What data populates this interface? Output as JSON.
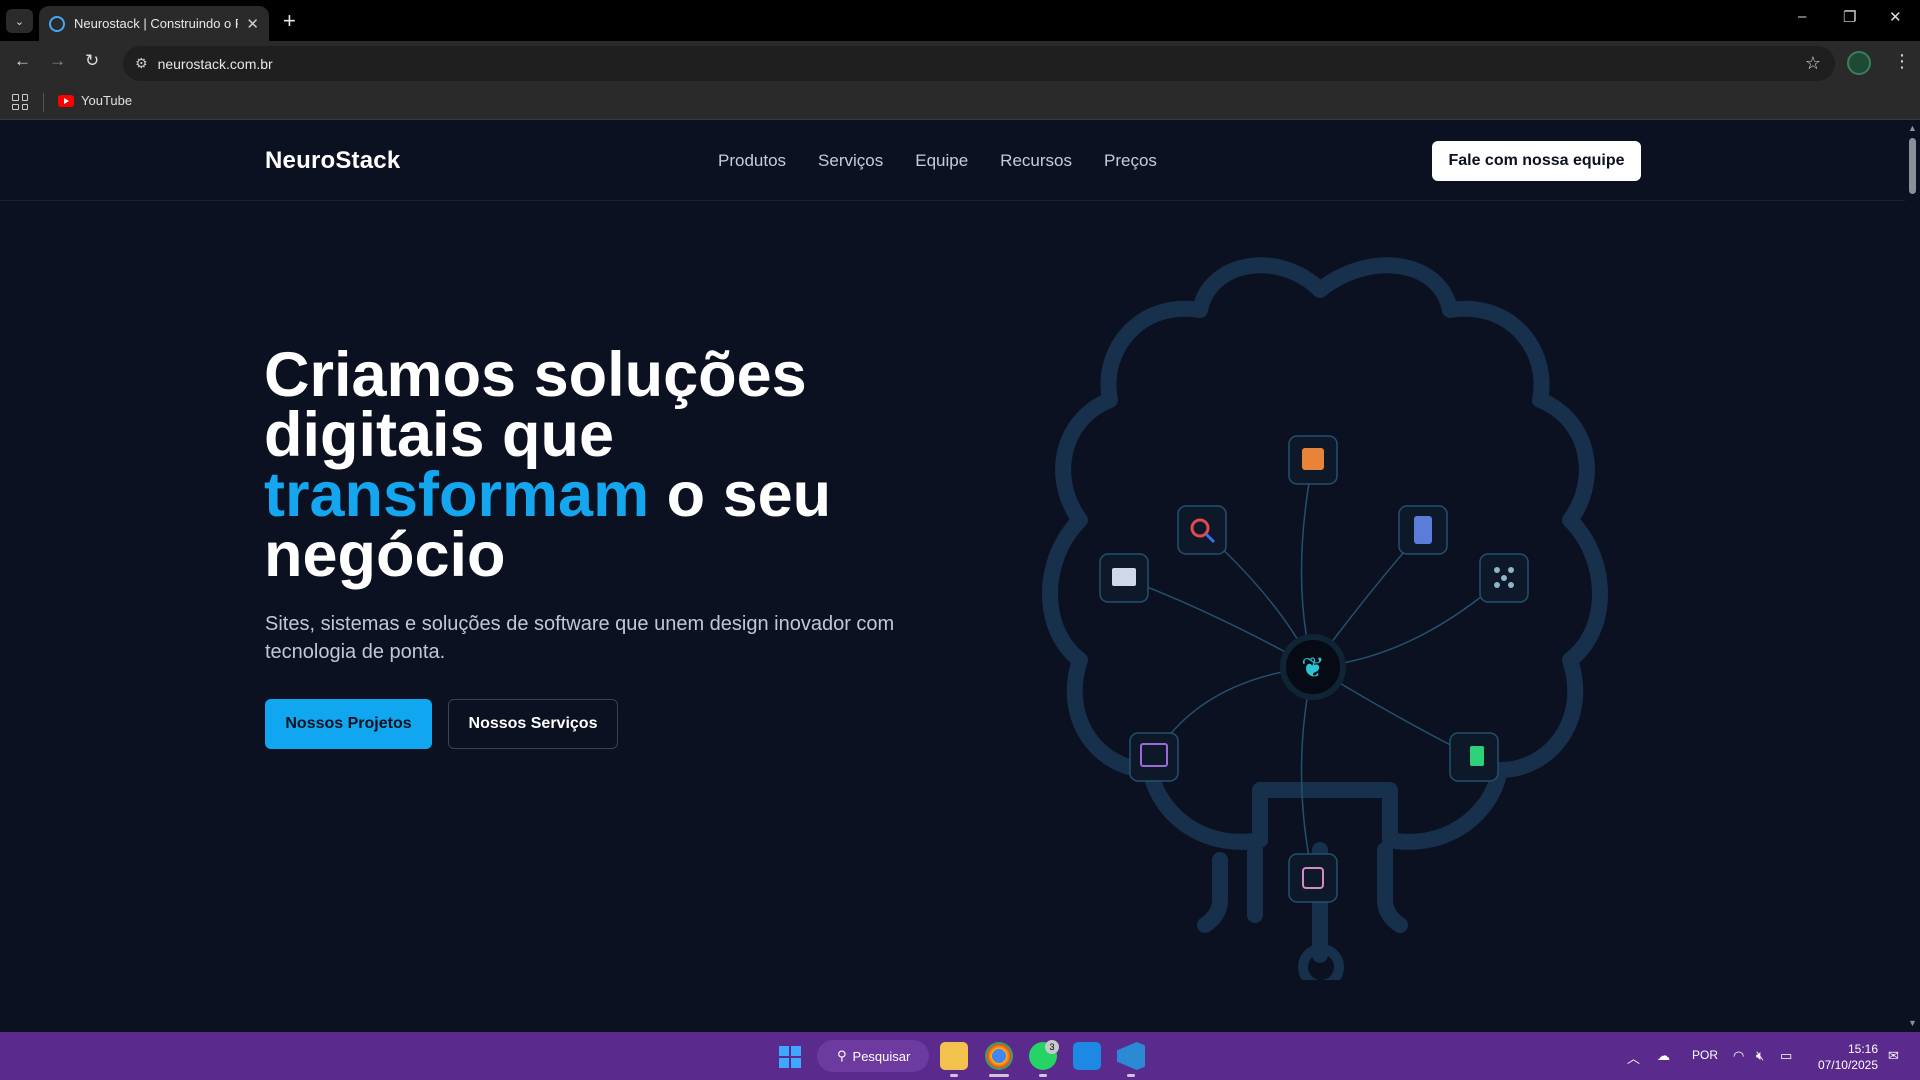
{
  "browser": {
    "tab_title": "Neurostack | Construindo o Futuro",
    "new_tab": "+",
    "tab_close": "✕",
    "url": "neurostack.com.br",
    "bookmarks": [
      {
        "label": "YouTube",
        "icon": "youtube-icon"
      }
    ],
    "window_controls": {
      "minimize": "–",
      "restore": "❐",
      "close": "✕"
    }
  },
  "site": {
    "logo": "NeuroStack",
    "nav": [
      "Produtos",
      "Serviços",
      "Equipe",
      "Recursos",
      "Preços"
    ],
    "cta": "Fale com nossa equipe",
    "hero": {
      "title_line1": "Criamos soluções",
      "title_line2": "digitais que",
      "title_accent": "transformam",
      "title_line3_rest": " o seu",
      "title_line4": "negócio",
      "subtitle": "Sites, sistemas e soluções de software que unem design inovador com tecnologia de ponta.",
      "primary_button": "Nossos Projetos",
      "secondary_button": "Nossos Serviços"
    },
    "colors": {
      "accent": "#14a7ef",
      "background": "#0b1120",
      "brain_outline": "#1b3550"
    }
  },
  "brain_nodes": [
    {
      "name": "store-icon"
    },
    {
      "name": "search-analytics-icon"
    },
    {
      "name": "mobile-app-icon"
    },
    {
      "name": "team-meeting-icon"
    },
    {
      "name": "network-icon"
    },
    {
      "name": "ai-brain-icon"
    },
    {
      "name": "web-design-icon"
    },
    {
      "name": "marketing-icon"
    },
    {
      "name": "chip-icon"
    }
  ],
  "taskbar": {
    "search_label": "Pesquisar",
    "whatsapp_badge": "3",
    "language": "POR",
    "time": "15:16",
    "date": "07/10/2025"
  }
}
